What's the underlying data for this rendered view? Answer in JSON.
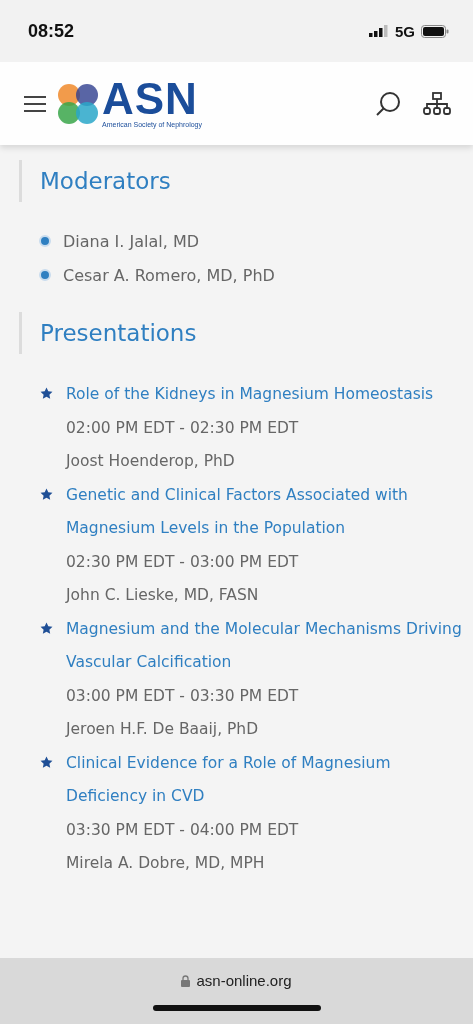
{
  "status_bar": {
    "time": "08:52",
    "network": "5G"
  },
  "header": {
    "logo_text": "ASN",
    "logo_subtitle": "American Society of Nephrology"
  },
  "moderators": {
    "heading": "Moderators",
    "items": [
      "Diana I. Jalal, MD",
      "Cesar A. Romero, MD, PhD"
    ]
  },
  "presentations": {
    "heading": "Presentations",
    "items": [
      {
        "title": "Role of the Kidneys in Magnesium Homeostasis",
        "time": "02:00 PM EDT - 02:30 PM EDT",
        "speaker": "Joost Hoenderop, PhD"
      },
      {
        "title": "Genetic and Clinical Factors Associated with Magnesium Levels in the Population",
        "time": "02:30 PM EDT - 03:00 PM EDT",
        "speaker": "John C. Lieske, MD, FASN"
      },
      {
        "title": "Magnesium and the Molecular Mechanisms Driving Vascular Calcification",
        "time": "03:00 PM EDT - 03:30 PM EDT",
        "speaker": "Jeroen H.F. De Baaij, PhD"
      },
      {
        "title": "Clinical Evidence for a Role of Magnesium Deficiency in CVD",
        "time": "03:30 PM EDT - 04:00 PM EDT",
        "speaker": "Mirela A. Dobre, MD, MPH"
      }
    ]
  },
  "url_bar": {
    "url": "asn-online.org"
  }
}
